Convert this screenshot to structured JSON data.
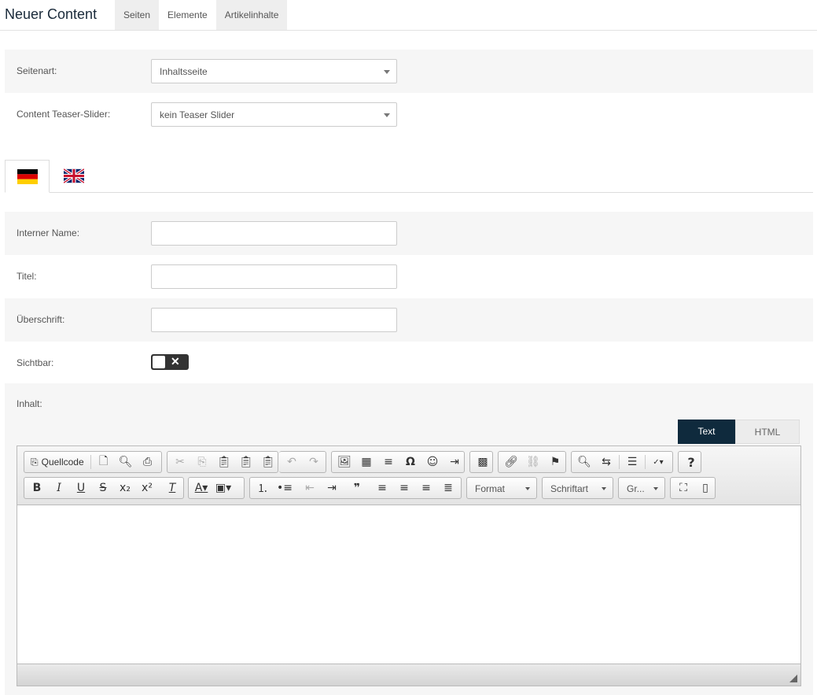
{
  "header": {
    "title": "Neuer Content",
    "tabs": [
      {
        "label": "Seiten"
      },
      {
        "label": "Elemente"
      },
      {
        "label": "Artikelinhalte"
      }
    ]
  },
  "form": {
    "seitenart": {
      "label": "Seitenart:",
      "value": "Inhaltsseite"
    },
    "teaser": {
      "label": "Content Teaser-Slider:",
      "value": "kein Teaser Slider"
    },
    "languages": [
      {
        "name": "de-flag-icon",
        "active": true
      },
      {
        "name": "uk-flag-icon",
        "active": false
      }
    ],
    "interner_name": {
      "label": "Interner Name:",
      "value": ""
    },
    "titel": {
      "label": "Titel:",
      "value": ""
    },
    "ueberschrift": {
      "label": "Überschrift:",
      "value": ""
    },
    "sichtbar": {
      "label": "Sichtbar:",
      "on": false,
      "off_glyph": "✕"
    },
    "inhalt": {
      "label": "Inhalt:"
    }
  },
  "editor": {
    "modes": [
      {
        "label": "Text",
        "active": true
      },
      {
        "label": "HTML",
        "active": false
      }
    ],
    "source_label": "Quellcode",
    "format_label": "Format",
    "font_label": "Schriftart",
    "size_label": "Gr..."
  },
  "colors": {
    "accent": "#0f2a3d",
    "row_alt": "#f6f6f6"
  }
}
